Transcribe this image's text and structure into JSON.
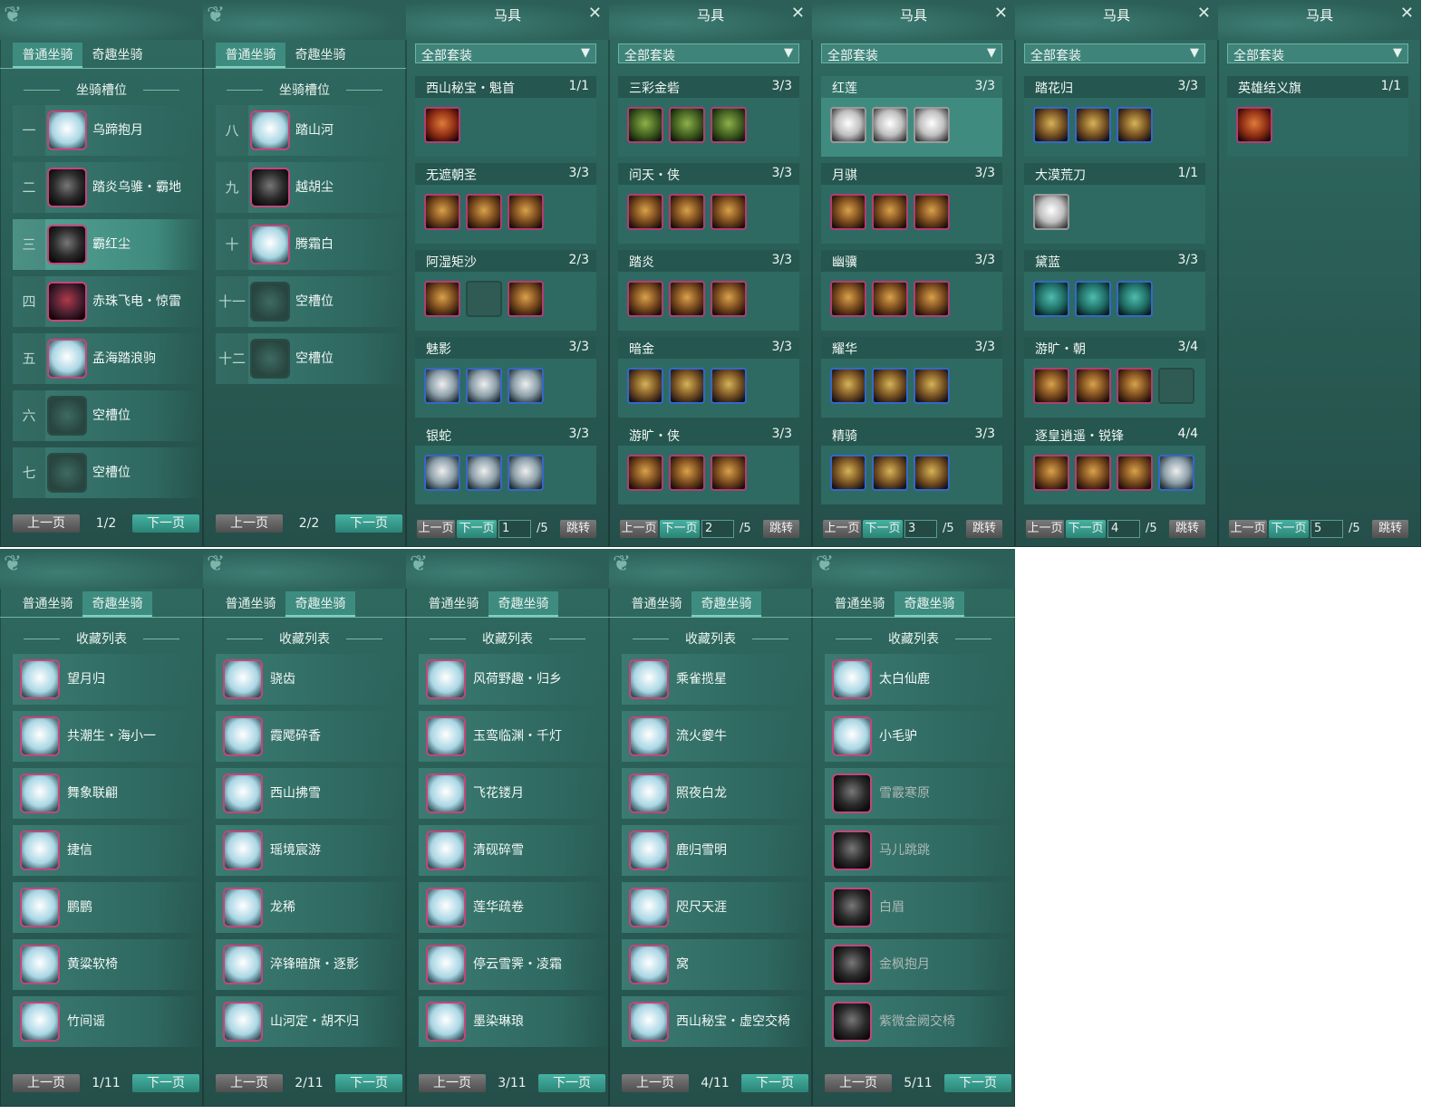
{
  "tabs": {
    "normal": "普通坐骑",
    "fun": "奇趣坐骑"
  },
  "section": {
    "slots": "坐骑槽位",
    "collection": "收藏列表"
  },
  "pager": {
    "prev": "上一页",
    "next": "下一页",
    "jump": "跳转"
  },
  "gear": {
    "title": "马具",
    "filter": "全部套装"
  },
  "mount_pages": [
    {
      "info": "1/2",
      "rows": [
        {
          "num": "一",
          "name": "乌蹄抱月",
          "icon": "white"
        },
        {
          "num": "二",
          "name": "踏炎乌骓・霸地",
          "icon": "dark"
        },
        {
          "num": "三",
          "name": "霸红尘",
          "icon": "dark",
          "selected": true
        },
        {
          "num": "四",
          "name": "赤珠飞电・惊雷",
          "icon": "red"
        },
        {
          "num": "五",
          "name": "孟海踏浪驹",
          "icon": "white"
        },
        {
          "num": "六",
          "name": "空槽位",
          "icon": "empty"
        },
        {
          "num": "七",
          "name": "空槽位",
          "icon": "empty"
        }
      ]
    },
    {
      "info": "2/2",
      "rows": [
        {
          "num": "八",
          "name": "踏山河",
          "icon": "white"
        },
        {
          "num": "九",
          "name": "越胡尘",
          "icon": "dark"
        },
        {
          "num": "十",
          "name": "腾霜白",
          "icon": "white"
        },
        {
          "num": "十一",
          "name": "空槽位",
          "icon": "empty"
        },
        {
          "num": "十二",
          "name": "空槽位",
          "icon": "empty"
        }
      ]
    }
  ],
  "gear_pages": [
    {
      "page": "1",
      "total": "/5",
      "sets": [
        {
          "name": "西山秘宝・魁首",
          "count": "1/1",
          "items": [
            "red"
          ]
        },
        {
          "name": "无遮朝圣",
          "count": "3/3",
          "items": [
            "gold",
            "gold",
            "gold"
          ]
        },
        {
          "name": "阿湿矩沙",
          "count": "2/3",
          "items": [
            "gold",
            "empty",
            "gold"
          ]
        },
        {
          "name": "魅影",
          "count": "3/3",
          "items": [
            "silver",
            "silver",
            "silver"
          ]
        },
        {
          "name": "银蛇",
          "count": "3/3",
          "items": [
            "silver",
            "silver",
            "silver"
          ]
        }
      ]
    },
    {
      "page": "2",
      "total": "/5",
      "sets": [
        {
          "name": "三彩金砦",
          "count": "3/3",
          "items": [
            "green",
            "green",
            "green"
          ]
        },
        {
          "name": "问天・侠",
          "count": "3/3",
          "items": [
            "gold",
            "gold",
            "gold"
          ]
        },
        {
          "name": "踏炎",
          "count": "3/3",
          "items": [
            "gold",
            "gold",
            "gold"
          ]
        },
        {
          "name": "暗金",
          "count": "3/3",
          "items": [
            "blue",
            "blue",
            "blue"
          ]
        },
        {
          "name": "游旷・侠",
          "count": "3/3",
          "items": [
            "gold",
            "gold",
            "gold"
          ]
        }
      ]
    },
    {
      "page": "3",
      "total": "/5",
      "sets": [
        {
          "name": "红莲",
          "count": "3/3",
          "items": [
            "white",
            "white",
            "white"
          ],
          "highlight": true
        },
        {
          "name": "月骐",
          "count": "3/3",
          "items": [
            "gold",
            "gold",
            "gold"
          ]
        },
        {
          "name": "幽骥",
          "count": "3/3",
          "items": [
            "gold",
            "gold",
            "gold"
          ]
        },
        {
          "name": "耀华",
          "count": "3/3",
          "items": [
            "blue",
            "blue",
            "blue"
          ]
        },
        {
          "name": "精骑",
          "count": "3/3",
          "items": [
            "blue",
            "blue",
            "blue"
          ]
        }
      ]
    },
    {
      "page": "4",
      "total": "/5",
      "sets": [
        {
          "name": "踏花归",
          "count": "3/3",
          "items": [
            "blue",
            "blue",
            "blue"
          ]
        },
        {
          "name": "大漠荒刀",
          "count": "1/1",
          "items": [
            "white"
          ]
        },
        {
          "name": "黛蓝",
          "count": "3/3",
          "items": [
            "teal",
            "teal",
            "teal"
          ]
        },
        {
          "name": "游旷・朝",
          "count": "3/4",
          "items": [
            "gold",
            "gold",
            "gold",
            "empty"
          ]
        },
        {
          "name": "逐皇逍遥・锐锋",
          "count": "4/4",
          "items": [
            "gold",
            "gold",
            "gold",
            "silver"
          ]
        }
      ]
    },
    {
      "page": "5",
      "total": "/5",
      "sets": [
        {
          "name": "英雄结义旗",
          "count": "1/1",
          "items": [
            "red"
          ]
        }
      ]
    }
  ],
  "collection_pages": [
    {
      "info": "1/11",
      "rows": [
        "望月归",
        "共潮生・海小一",
        "舞象联翩",
        "捷信",
        "鹏鹏",
        "黄粱软椅",
        "竹间谣"
      ]
    },
    {
      "info": "2/11",
      "rows": [
        "骁齿",
        "霞飔碎香",
        "西山拂雪",
        "瑶境宸游",
        "龙稀",
        "淬锋暗旗・逐影",
        "山河定・胡不归"
      ]
    },
    {
      "info": "3/11",
      "rows": [
        "风荷野趣・归乡",
        "玉鸾临渊・千灯",
        "飞花镂月",
        "清砚碎雪",
        "莲华疏卷",
        "停云雪霁・凌霜",
        "墨染琳琅"
      ]
    },
    {
      "info": "4/11",
      "rows": [
        "乘雀揽星",
        "流火夔牛",
        "照夜白龙",
        "鹿归雪明",
        "咫尺天涯",
        "窝",
        "西山秘宝・虚空交椅"
      ]
    },
    {
      "info": "5/11",
      "rows": [
        "太白仙鹿",
        "小毛驴",
        "雪霰寒原",
        "马儿跳跳",
        "白眉",
        "金枫抱月",
        "紫微金阙交椅"
      ],
      "gray_from": 2
    }
  ]
}
